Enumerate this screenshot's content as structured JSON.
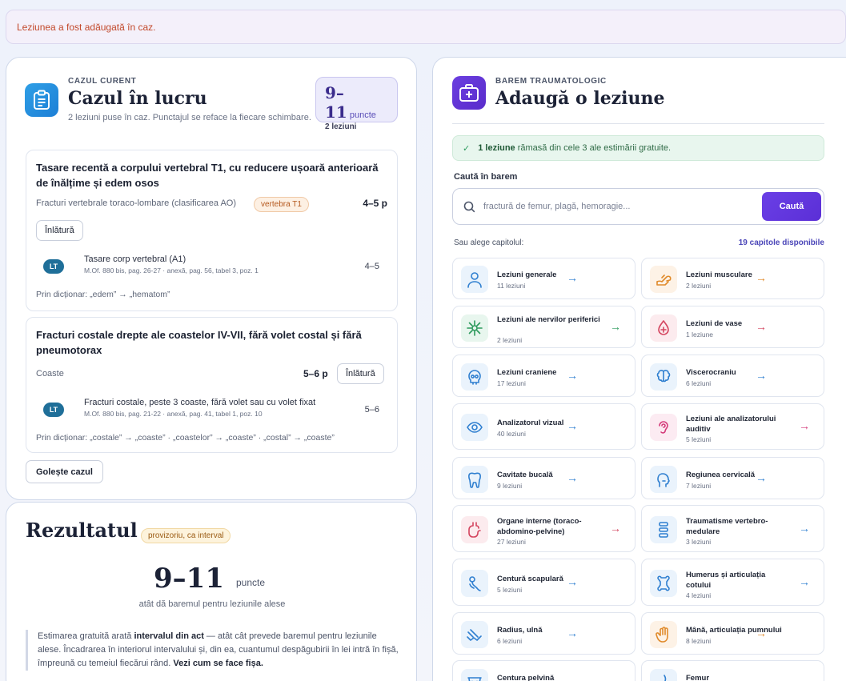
{
  "toast": {
    "message": "Leziunea a fost adăugată în caz."
  },
  "case": {
    "eyebrow": "CAZUL CURENT",
    "title": "Cazul în lucru",
    "subtitle": "2 leziuni puse în caz. Punctajul se reface la fiecare schimbare.",
    "score": {
      "range": "9–11",
      "unit": "puncte",
      "count": "2 leziuni"
    },
    "lesions": [
      {
        "title": "Tasare recentă a corpului vertebral T1, cu reducere ușoară anterioară de înălțime și edem osos",
        "category": "Fracturi vertebrale toraco-lombare (clasificarea AO)",
        "tag": "vertebra T1",
        "points": "4–5 p",
        "remove_label": "Înlătură",
        "ref": {
          "badge": "LT",
          "title": "Tasare corp vertebral (A1)",
          "meta": "M.Of. 880 bis, pag. 26-27 · anexă, pag. 56, tabel 3, poz. 1",
          "points": "4–5"
        },
        "dictionary": "Prin dicționar: „edem” → „hematom”"
      },
      {
        "title": "Fracturi costale drepte ale coastelor IV-VII, fără volet costal și fără pneumotorax",
        "category": "Coaste",
        "points": "5–6 p",
        "remove_label": "Înlătură",
        "ref": {
          "badge": "LT",
          "title": "Fracturi costale, peste 3 coaste, fără volet sau cu volet fixat",
          "meta": "M.Of. 880 bis, pag. 21-22 · anexă, pag. 41, tabel 1, poz. 10",
          "points": "5–6"
        },
        "dictionary": "Prin dicționar: „costale” → „coaste” · „coastelor” → „coaste” · „costal” → „coaste”"
      }
    ],
    "clear_label": "Golește cazul"
  },
  "result": {
    "title": "Rezultatul",
    "tag": "provizoriu, ca interval",
    "range": "9–11",
    "unit": "puncte",
    "subtitle": "atât dă baremul pentru leziunile alese",
    "note_1": "Estimarea gratuită arată ",
    "note_bold": "intervalul din act",
    "note_2": " — atât cât prevede baremul pentru leziunile alese. Încadrarea în interiorul intervalului și, din ea, cuantumul despăgubirii în lei intră în fișă, împreună cu temeiul fiecărui rând. ",
    "note_link": "Vezi cum se face fișa."
  },
  "barem": {
    "eyebrow": "BAREM TRAUMATOLOGIC",
    "title": "Adaugă o leziune",
    "alert_count": "1 leziune",
    "alert_text": "rămasă din cele 3 ale estimării gratuite.",
    "search_label": "Caută în barem",
    "search_placeholder": "fractură de femur, plagă, hemoragie...",
    "search_button": "Caută",
    "chapters_label": "Sau alege capitolul:",
    "chapters_count": "19 capitole disponibile",
    "chapters": [
      {
        "name": "Leziuni generale",
        "count": "11 leziuni",
        "icon": "person-icon",
        "color": "#2f7fd0",
        "bg": "#eaf3fc"
      },
      {
        "name": "Leziuni musculare",
        "count": "2 leziuni",
        "icon": "muscle-arm-icon",
        "color": "#e08a2a",
        "bg": "#fdf2e6"
      },
      {
        "name": "Leziuni ale nervilor periferici",
        "count": "2 leziuni",
        "icon": "nerve-icon",
        "color": "#2c9a5c",
        "bg": "#e8f6ee"
      },
      {
        "name": "Leziuni de vase",
        "count": "1 leziune",
        "icon": "blood-drop-icon",
        "color": "#d4455f",
        "bg": "#fcebee"
      },
      {
        "name": "Leziuni craniene",
        "count": "17 leziuni",
        "icon": "skull-icon",
        "color": "#2f7fd0",
        "bg": "#eaf3fc"
      },
      {
        "name": "Viscerocraniu",
        "count": "6 leziuni",
        "icon": "brain-icon",
        "color": "#2f7fd0",
        "bg": "#eaf3fc"
      },
      {
        "name": "Analizatorul vizual",
        "count": "40 leziuni",
        "icon": "eye-icon",
        "color": "#2f7fd0",
        "bg": "#eaf3fc"
      },
      {
        "name": "Leziuni ale analizatorului auditiv",
        "count": "5 leziuni",
        "icon": "ear-icon",
        "color": "#d43b7a",
        "bg": "#fcebf2"
      },
      {
        "name": "Cavitate bucală",
        "count": "9 leziuni",
        "icon": "tooth-icon",
        "color": "#2f7fd0",
        "bg": "#eaf3fc"
      },
      {
        "name": "Regiunea cervicală",
        "count": "7 leziuni",
        "icon": "head-neck-icon",
        "color": "#2f7fd0",
        "bg": "#eaf3fc"
      },
      {
        "name": "Organe interne (toraco-abdomino-pelvine)",
        "count": "27 leziuni",
        "icon": "stomach-icon",
        "color": "#d4455f",
        "bg": "#fcebee"
      },
      {
        "name": "Traumatisme vertebro-medulare",
        "count": "3 leziuni",
        "icon": "spine-icon",
        "color": "#2f7fd0",
        "bg": "#eaf3fc"
      },
      {
        "name": "Centură scapulară",
        "count": "5 leziuni",
        "icon": "shoulder-icon",
        "color": "#2f7fd0",
        "bg": "#eaf3fc"
      },
      {
        "name": "Humerus și articulația cotului",
        "count": "4 leziuni",
        "icon": "bone-icon",
        "color": "#2f7fd0",
        "bg": "#eaf3fc"
      },
      {
        "name": "Radius, ulnă",
        "count": "6 leziuni",
        "icon": "forearm-icon",
        "color": "#2f7fd0",
        "bg": "#eaf3fc"
      },
      {
        "name": "Mână, articulația pumnului",
        "count": "8 leziuni",
        "icon": "hand-icon",
        "color": "#e08a2a",
        "bg": "#fdf2e6"
      },
      {
        "name": "Centura pelvină",
        "count": "",
        "icon": "pelvis-icon",
        "color": "#2f7fd0",
        "bg": "#eaf3fc"
      },
      {
        "name": "Femur",
        "count": "",
        "icon": "leg-icon",
        "color": "#2f7fd0",
        "bg": "#eaf3fc"
      }
    ]
  }
}
